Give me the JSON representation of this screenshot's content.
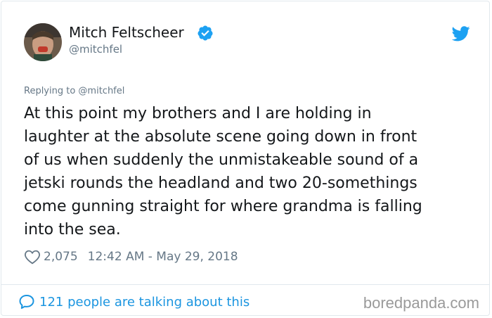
{
  "tweet": {
    "display_name": "Mitch Feltscheer",
    "handle": "@mitchfel",
    "replying_to": "Replying to @mitchfel",
    "body_lines": [
      "At this point my brothers and I are holding in",
      "laughter at the absolute scene going down in front",
      "of us when suddenly the unmistakeable sound of a",
      "jetski rounds the headland and two 20-somethings",
      "come gunning straight for where grandma is falling",
      "into the sea."
    ],
    "likes": "2,075",
    "timestamp": "12:42 AM - May 29, 2018",
    "conversation": "121 people are talking about this"
  },
  "watermark": "boredpanda.com",
  "icons": {
    "verified": "verified-badge-icon",
    "twitter": "twitter-bird-icon",
    "like": "heart-icon",
    "conversation": "speech-bubble-icon"
  },
  "colors": {
    "accent": "#1da1f2",
    "link": "#1b95e0",
    "muted": "#657786",
    "text": "#14171a"
  }
}
